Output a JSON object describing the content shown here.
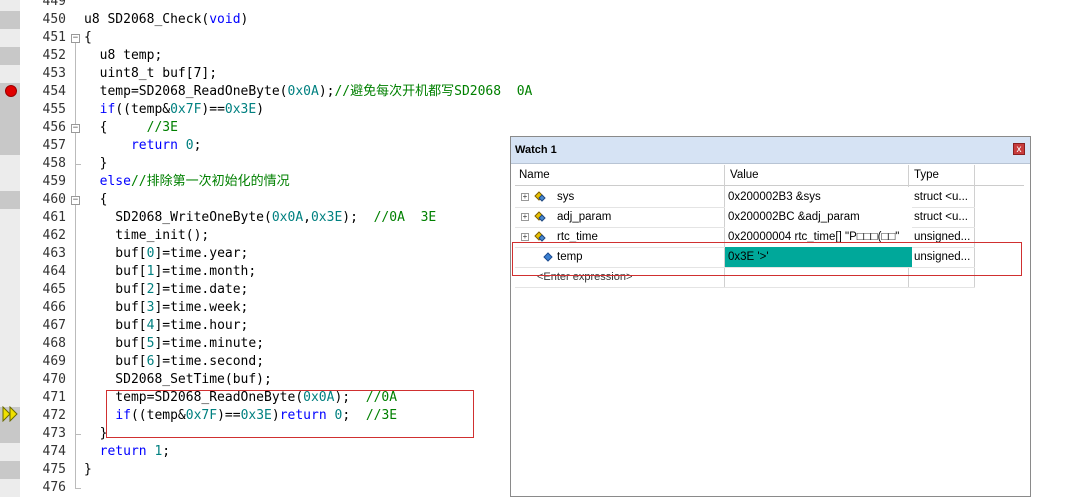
{
  "editor": {
    "lines": [
      {
        "n": "449",
        "code": []
      },
      {
        "n": "450",
        "code": [
          [
            "",
            "u8 SD2068_Check("
          ],
          [
            "kw",
            "void"
          ],
          [
            "",
            ")"
          ]
        ]
      },
      {
        "n": "451",
        "code": [
          [
            "",
            "{"
          ]
        ]
      },
      {
        "n": "452",
        "code": [
          [
            "",
            "  u8 temp;"
          ]
        ]
      },
      {
        "n": "453",
        "code": [
          [
            "",
            "  uint8_t buf[7];"
          ]
        ]
      },
      {
        "n": "454",
        "code": [
          [
            "",
            "  temp=SD2068_ReadOneByte("
          ],
          [
            "num",
            "0x0A"
          ],
          [
            "",
            ");"
          ],
          [
            "cm",
            "//避免每次开机都写SD2068  0A"
          ]
        ]
      },
      {
        "n": "455",
        "code": [
          [
            "",
            "  "
          ],
          [
            "kw",
            "if"
          ],
          [
            "",
            "((temp&"
          ],
          [
            "num",
            "0x7F"
          ],
          [
            "",
            ")=="
          ],
          [
            "num",
            "0x3E"
          ],
          [
            "",
            ")"
          ]
        ]
      },
      {
        "n": "456",
        "code": [
          [
            "",
            "  {     "
          ],
          [
            "cm",
            "//3E"
          ]
        ]
      },
      {
        "n": "457",
        "code": [
          [
            "",
            "      "
          ],
          [
            "kw",
            "return"
          ],
          [
            "",
            ""
          ],
          [
            "num",
            " 0"
          ],
          [
            "",
            ";"
          ]
        ]
      },
      {
        "n": "458",
        "code": [
          [
            "",
            "  }"
          ]
        ]
      },
      {
        "n": "459",
        "code": [
          [
            "",
            "  "
          ],
          [
            "kw",
            "else"
          ],
          [
            "cm",
            "//排除第一次初始化的情况"
          ]
        ]
      },
      {
        "n": "460",
        "code": [
          [
            "",
            "  {"
          ]
        ]
      },
      {
        "n": "461",
        "code": [
          [
            "",
            "    SD2068_WriteOneByte("
          ],
          [
            "num",
            "0x0A"
          ],
          [
            "",
            ","
          ],
          [
            "num",
            "0x3E"
          ],
          [
            "",
            ");  "
          ],
          [
            "cm",
            "//0A  3E"
          ]
        ]
      },
      {
        "n": "462",
        "code": [
          [
            "",
            "    time_init();"
          ]
        ]
      },
      {
        "n": "463",
        "code": [
          [
            "",
            "    buf["
          ],
          [
            "num",
            "0"
          ],
          [
            "",
            "]=time.year;"
          ]
        ]
      },
      {
        "n": "464",
        "code": [
          [
            "",
            "    buf["
          ],
          [
            "num",
            "1"
          ],
          [
            "",
            "]=time.month;"
          ]
        ]
      },
      {
        "n": "465",
        "code": [
          [
            "",
            "    buf["
          ],
          [
            "num",
            "2"
          ],
          [
            "",
            "]=time.date;"
          ]
        ]
      },
      {
        "n": "466",
        "code": [
          [
            "",
            "    buf["
          ],
          [
            "num",
            "3"
          ],
          [
            "",
            "]=time.week;"
          ]
        ]
      },
      {
        "n": "467",
        "code": [
          [
            "",
            "    buf["
          ],
          [
            "num",
            "4"
          ],
          [
            "",
            "]=time.hour;"
          ]
        ]
      },
      {
        "n": "468",
        "code": [
          [
            "",
            "    buf["
          ],
          [
            "num",
            "5"
          ],
          [
            "",
            "]=time.minute;"
          ]
        ]
      },
      {
        "n": "469",
        "code": [
          [
            "",
            "    buf["
          ],
          [
            "num",
            "6"
          ],
          [
            "",
            "]=time.second;"
          ]
        ]
      },
      {
        "n": "470",
        "code": [
          [
            "",
            "    SD2068_SetTime(buf);"
          ]
        ]
      },
      {
        "n": "471",
        "code": [
          [
            "",
            "    temp=SD2068_ReadOneByte("
          ],
          [
            "num",
            "0x0A"
          ],
          [
            "",
            ");  "
          ],
          [
            "cm",
            "//0A"
          ]
        ]
      },
      {
        "n": "472",
        "code": [
          [
            "",
            "    "
          ],
          [
            "kw",
            "if"
          ],
          [
            "",
            "((temp&"
          ],
          [
            "num",
            "0x7F"
          ],
          [
            "",
            ")=="
          ],
          [
            "num",
            "0x3E"
          ],
          [
            "",
            ")"
          ],
          [
            "kw",
            "return"
          ],
          [
            "num",
            " 0"
          ],
          [
            "",
            ";  "
          ],
          [
            "cm",
            "//3E"
          ]
        ]
      },
      {
        "n": "473",
        "code": [
          [
            "",
            "  }"
          ]
        ]
      },
      {
        "n": "474",
        "code": [
          [
            "",
            "  "
          ],
          [
            "kw",
            "return"
          ],
          [
            "num",
            " 1"
          ],
          [
            "",
            ";"
          ]
        ]
      },
      {
        "n": "475",
        "code": [
          [
            "",
            "}"
          ]
        ]
      },
      {
        "n": "476",
        "code": []
      }
    ]
  },
  "watch": {
    "title": "Watch 1",
    "close": "x",
    "columns": {
      "name": "Name",
      "value": "Value",
      "type": "Type"
    },
    "rows": [
      {
        "name": "sys",
        "value": "0x200002B3 &sys",
        "type": "struct <u...",
        "expandable": true,
        "highlight": false
      },
      {
        "name": "adj_param",
        "value": "0x200002BC &adj_param",
        "type": "struct <u...",
        "expandable": true,
        "highlight": false
      },
      {
        "name": "rtc_time",
        "value": "0x20000004 rtc_time[] \"P□□□(□□\"",
        "type": "unsigned...",
        "expandable": true,
        "highlight": false
      },
      {
        "name": "temp",
        "value": "0x3E '>'",
        "type": "unsigned...",
        "expandable": false,
        "highlight": true
      }
    ],
    "enter_expression": "<Enter expression>"
  },
  "colors": {
    "keyword": "#0000ff",
    "number": "#008080",
    "comment": "#008000",
    "highlight": "#00a89a",
    "annotation": "#d03030"
  }
}
